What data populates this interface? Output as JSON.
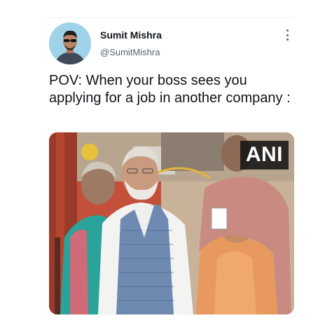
{
  "tweet": {
    "author_name": "Sumit Mishra",
    "author_handle": "@SumitMishra",
    "text": "POV: When your boss sees you applying for a job in another company :"
  },
  "media": {
    "watermark": "ANI"
  },
  "icons": {
    "more_options": "more-options-icon"
  },
  "colors": {
    "name_text": "#0f1419",
    "handle_text": "#536471",
    "avatar_bg": "#9fd3ea"
  }
}
